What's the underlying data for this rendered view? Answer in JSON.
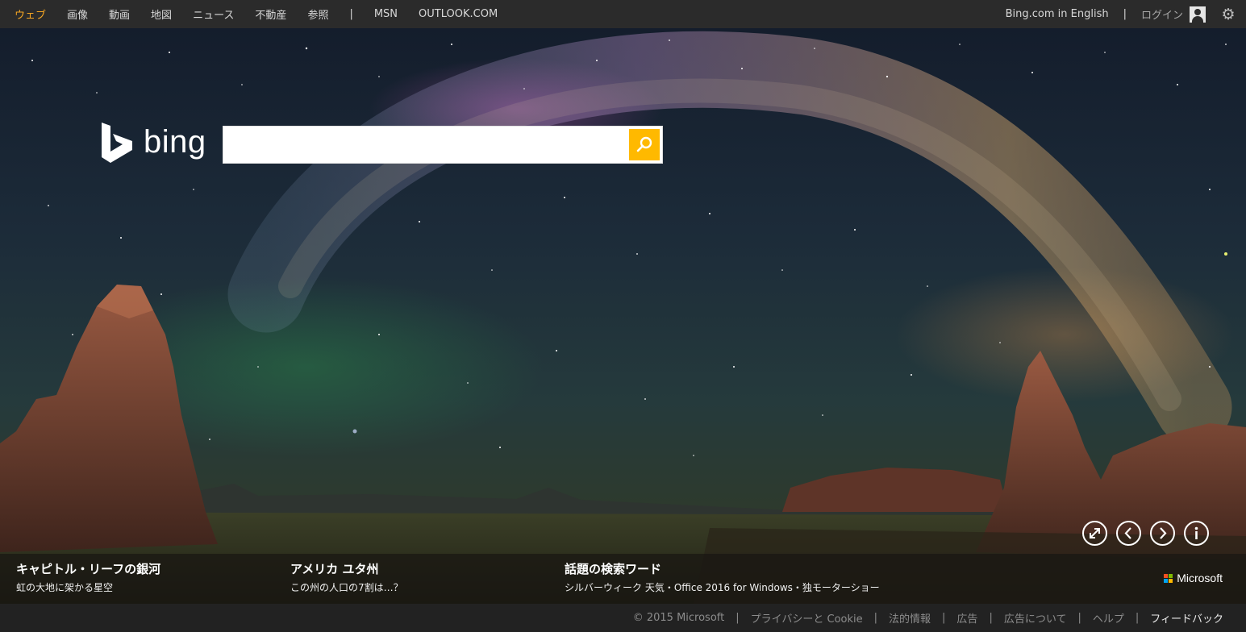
{
  "topnav": {
    "items": [
      {
        "label": "ウェブ",
        "active": true
      },
      {
        "label": "画像"
      },
      {
        "label": "動画"
      },
      {
        "label": "地図"
      },
      {
        "label": "ニュース"
      },
      {
        "label": "不動産"
      },
      {
        "label": "参照"
      }
    ],
    "separator": "|",
    "extra": [
      {
        "label": "MSN"
      },
      {
        "label": "OUTLOOK.COM"
      }
    ],
    "active_color": "#f5a623"
  },
  "topright": {
    "lang_link": "Bing.com in English",
    "separator": "|",
    "login": "ログイン",
    "icons": [
      "user-icon",
      "gear-icon"
    ]
  },
  "logo": {
    "word": "bing"
  },
  "search": {
    "value": "",
    "placeholder": "",
    "button_color": "#ffb900"
  },
  "controls": [
    "expand-icon",
    "chevron-left-icon",
    "chevron-right-icon",
    "info-icon"
  ],
  "info": [
    {
      "title": "キャピトル・リーフの銀河",
      "subtitle": "虹の大地に架かる星空"
    },
    {
      "title": "アメリカ ユタ州",
      "subtitle": "この州の人口の7割は…？"
    },
    {
      "title": "話題の検索ワード",
      "subtitle": "シルバーウィーク 天気・Office 2016 for Windows・独モーターショー"
    }
  ],
  "microsoft": {
    "word": "Microsoft",
    "colors": [
      "#f25022",
      "#7fba00",
      "#00a4ef",
      "#ffb900"
    ]
  },
  "footer": {
    "separator": "|",
    "links": [
      {
        "label": "© 2015 Microsoft"
      },
      {
        "label": "プライバシーと Cookie"
      },
      {
        "label": "法的情報"
      },
      {
        "label": "広告"
      },
      {
        "label": "広告について"
      },
      {
        "label": "ヘルプ"
      },
      {
        "label": "フィードバック",
        "strong": true
      }
    ]
  }
}
